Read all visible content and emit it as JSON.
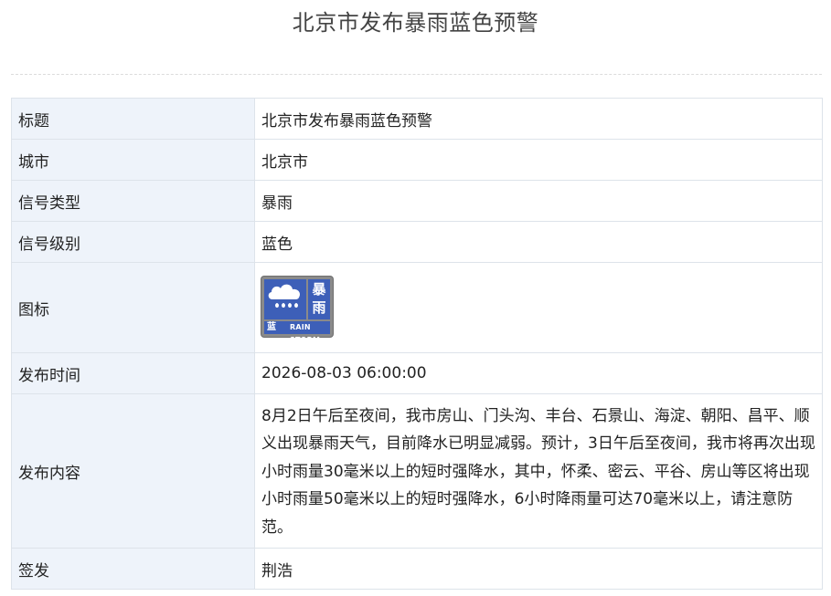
{
  "page": {
    "title": "北京市发布暴雨蓝色预警"
  },
  "table": {
    "title_label": "标题",
    "title_value": "北京市发布暴雨蓝色预警",
    "city_label": "城市",
    "city_value": "北京市",
    "signal_type_label": "信号类型",
    "signal_type_value": "暴雨",
    "signal_level_label": "信号级别",
    "signal_level_value": "蓝色",
    "icon_label": "图标",
    "icon": {
      "name": "rainstorm-blue-warning-icon",
      "chars_top": "暴",
      "chars_bottom": "雨",
      "level_char": "蓝",
      "english": "RAIN STORM",
      "color": "#3d5fb8"
    },
    "time_label": "发布时间",
    "time_value": "2026-08-03 06:00:00",
    "content_label": "发布内容",
    "content_value": "8月2日午后至夜间，我市房山、门头沟、丰台、石景山、海淀、朝阳、昌平、顺义出现暴雨天气，目前降水已明显减弱。预计，3日午后至夜间，我市将再次出现小时雨量30毫米以上的短时强降水，其中，怀柔、密云、平谷、房山等区将出现小时雨量50毫米以上的短时强降水，6小时降雨量可达70毫米以上，请注意防范。",
    "signer_label": "签发",
    "signer_value": "荆浩"
  }
}
